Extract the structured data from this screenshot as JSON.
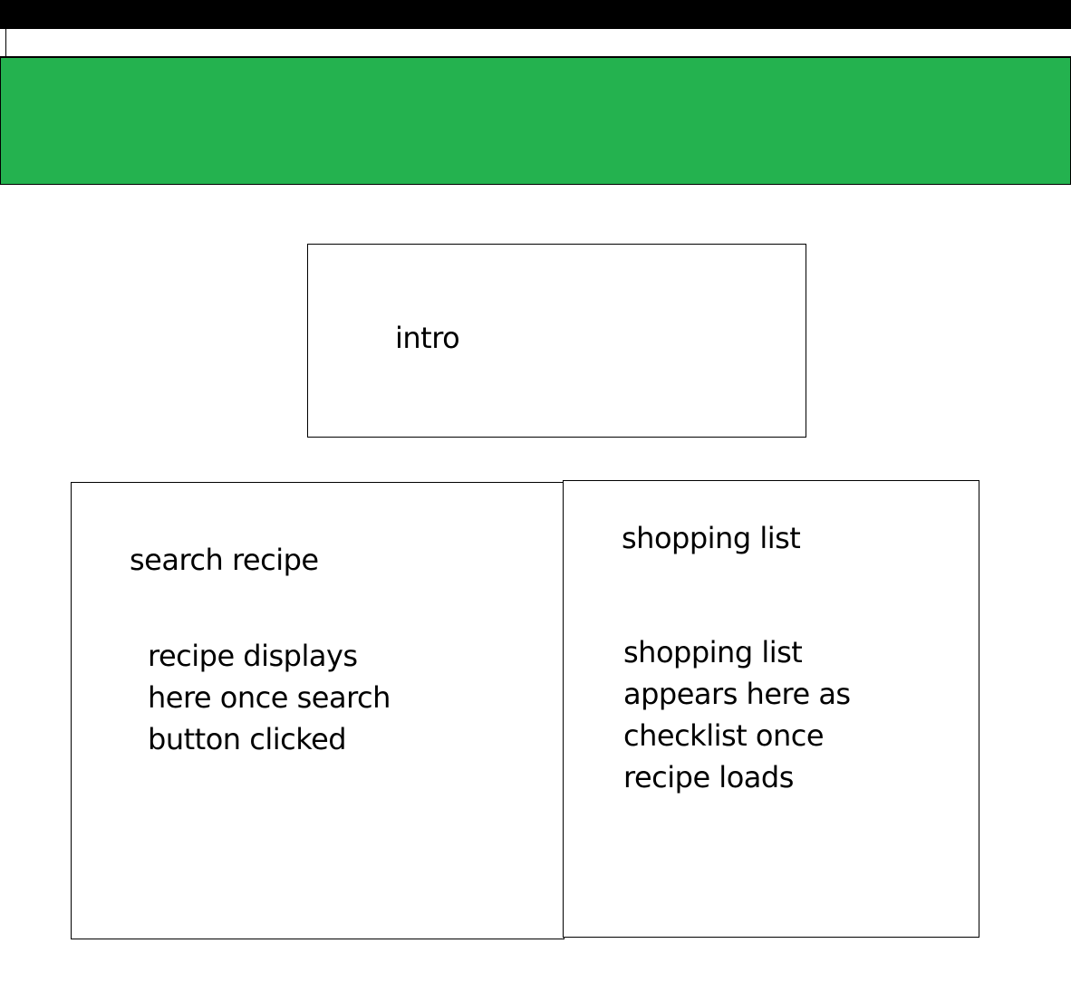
{
  "colors": {
    "top_bar": "#000000",
    "banner": "#24b24f",
    "border": "#000000"
  },
  "intro": {
    "label": "intro"
  },
  "search": {
    "heading": "search recipe",
    "description": "recipe displays\nhere once search\nbutton clicked"
  },
  "shopping": {
    "heading": "shopping list",
    "description": "shopping list\nappears here as\nchecklist once\nrecipe loads"
  }
}
